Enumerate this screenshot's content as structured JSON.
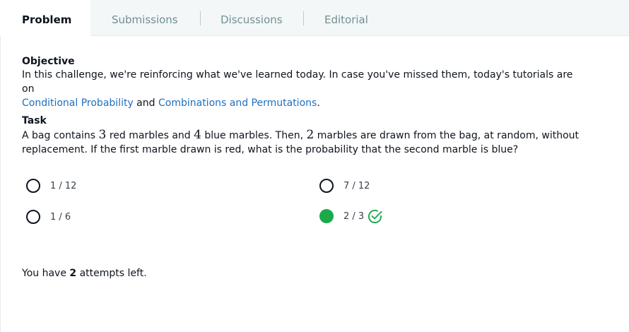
{
  "tabs": [
    {
      "label": "Problem",
      "active": true
    },
    {
      "label": "Submissions",
      "active": false
    },
    {
      "label": "Discussions",
      "active": false
    },
    {
      "label": "Editorial",
      "active": false
    }
  ],
  "objective": {
    "title": "Objective",
    "text_before": "In this challenge, we're reinforcing what we've learned today. In case you've missed them, today's tutorials are on ",
    "link1": "Conditional Probability",
    "text_middle": " and ",
    "link2": "Combinations and Permutations",
    "text_after": "."
  },
  "task": {
    "title": "Task",
    "seg1": "A bag contains ",
    "num_red": "3",
    "seg2": " red marbles and ",
    "num_blue": "4",
    "seg3": " blue marbles. Then, ",
    "num_drawn": "2",
    "seg4": " marbles are drawn from the bag, at random, without",
    "line2": "replacement. If the first marble drawn is red, what is the probability that the second marble is blue?"
  },
  "options": [
    {
      "label": "1 / 12",
      "selected": false
    },
    {
      "label": "7 / 12",
      "selected": false
    },
    {
      "label": "1 / 6",
      "selected": false
    },
    {
      "label": "2 / 3",
      "selected": true,
      "correct": true,
      "check_icon": "check-circle-icon"
    }
  ],
  "attempts": {
    "prefix": "You have ",
    "count": "2",
    "suffix": " attempts left."
  },
  "colors": {
    "selected": "#1ba94c",
    "link": "#1f6fbf",
    "tabbar_bg": "#f3f7f7"
  }
}
